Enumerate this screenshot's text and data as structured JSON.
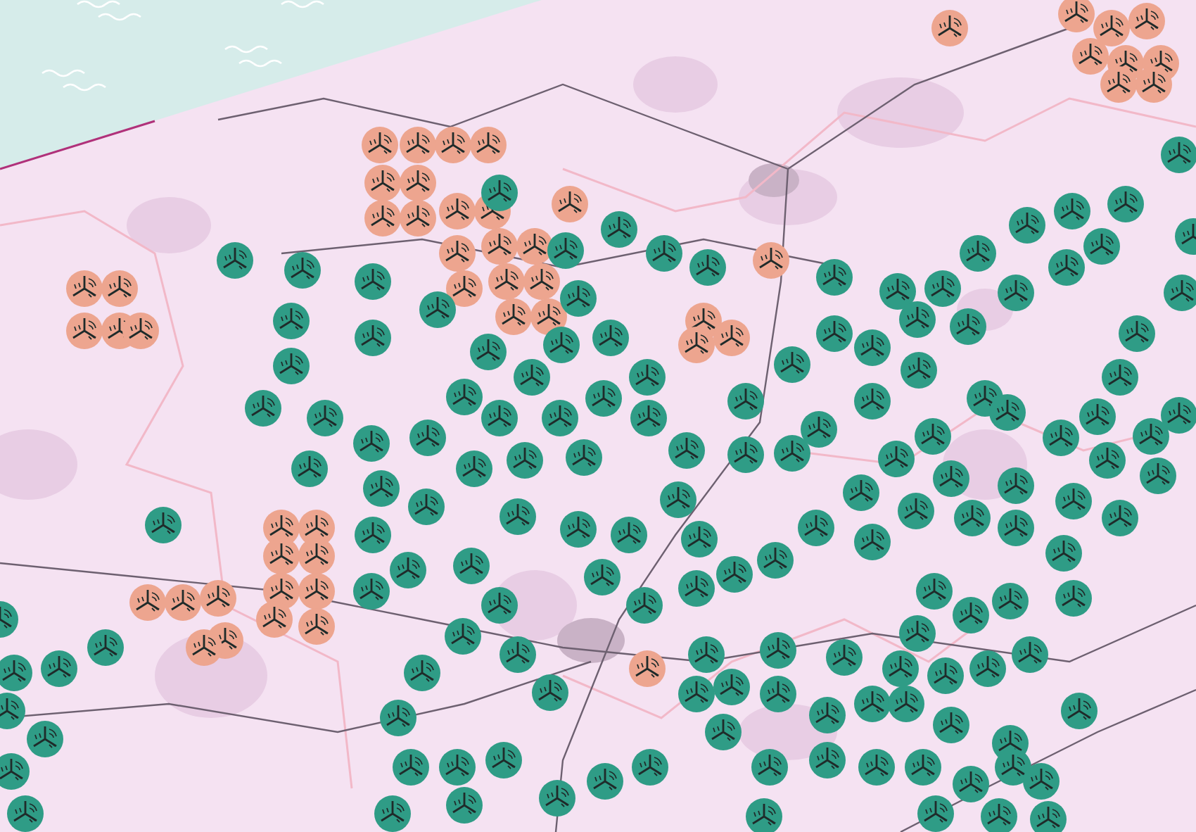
{
  "marker_kinds": [
    {
      "kind": "existing",
      "color": "#2f9c86"
    },
    {
      "kind": "planned",
      "color": "#eda58f"
    }
  ]
}
